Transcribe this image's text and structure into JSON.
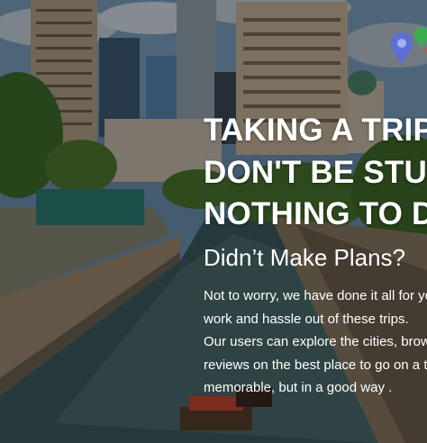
{
  "hero": {
    "headline_lines": [
      "TAKING A TRIP?",
      "DON'T BE STUCK WITH",
      "NOTHING TO DO"
    ],
    "subheading": "Didn’t Make Plans?",
    "body_lines": [
      "Not to worry, we have done it all for you, taking the",
      "work and hassle out of these trips.",
      "Our users can explore the cities, browse and write",
      "reviews on the best place to go on a trip that is",
      "memorable, but in a good way ."
    ]
  },
  "icons": [
    "map-pin-icon"
  ],
  "colors": {
    "text": "#ffffff",
    "overlay": "rgba(0,0,0,0.38)"
  }
}
